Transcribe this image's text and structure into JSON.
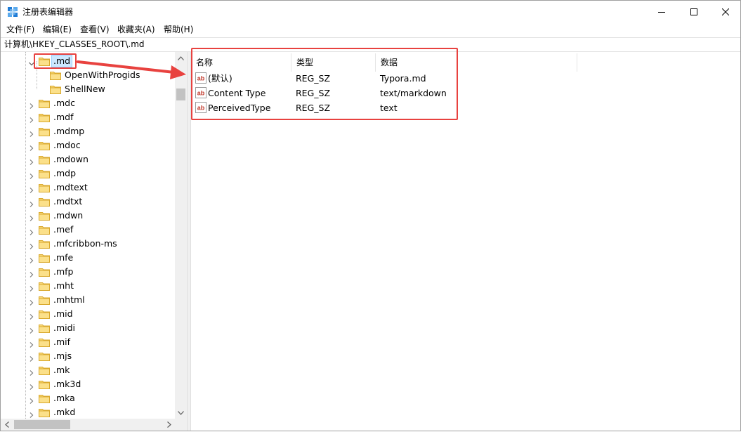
{
  "window": {
    "title": "注册表编辑器",
    "icon": "registry-editor-icon",
    "controls": [
      "minimize-icon",
      "maximize-icon",
      "close-icon"
    ]
  },
  "menu": {
    "items": [
      {
        "label": "文件(F)"
      },
      {
        "label": "编辑(E)"
      },
      {
        "label": "查看(V)"
      },
      {
        "label": "收藏夹(A)"
      },
      {
        "label": "帮助(H)"
      }
    ]
  },
  "address": {
    "path": "计算机\\HKEY_CLASSES_ROOT\\.md"
  },
  "tree": {
    "selected": {
      "label": ".md",
      "expanded": true,
      "icon": "folder-icon"
    },
    "children": [
      {
        "label": "OpenWithProgids",
        "icon": "folder-icon"
      },
      {
        "label": "ShellNew",
        "icon": "folder-icon"
      }
    ],
    "siblings": [
      {
        "label": ".mdc"
      },
      {
        "label": ".mdf"
      },
      {
        "label": ".mdmp"
      },
      {
        "label": ".mdoc"
      },
      {
        "label": ".mdown"
      },
      {
        "label": ".mdp"
      },
      {
        "label": ".mdtext"
      },
      {
        "label": ".mdtxt"
      },
      {
        "label": ".mdwn"
      },
      {
        "label": ".mef"
      },
      {
        "label": ".mfcribbon-ms"
      },
      {
        "label": ".mfe"
      },
      {
        "label": ".mfp"
      },
      {
        "label": ".mht"
      },
      {
        "label": ".mhtml"
      },
      {
        "label": ".mid"
      },
      {
        "label": ".midi"
      },
      {
        "label": ".mif"
      },
      {
        "label": ".mjs"
      },
      {
        "label": ".mk"
      },
      {
        "label": ".mk3d"
      },
      {
        "label": ".mka"
      },
      {
        "label": ".mkd"
      }
    ]
  },
  "values_list": {
    "columns": [
      {
        "label": "名称"
      },
      {
        "label": "类型"
      },
      {
        "label": "数据"
      }
    ],
    "rows": [
      {
        "name": "(默认)",
        "type": "REG_SZ",
        "data": "Typora.md",
        "icon": "string-value-icon"
      },
      {
        "name": "Content Type",
        "type": "REG_SZ",
        "data": "text/markdown",
        "icon": "string-value-icon"
      },
      {
        "name": "PerceivedType",
        "type": "REG_SZ",
        "data": "text",
        "icon": "string-value-icon"
      }
    ]
  },
  "annotation_color": "#e8423f",
  "selection_color": "#cce8ff"
}
